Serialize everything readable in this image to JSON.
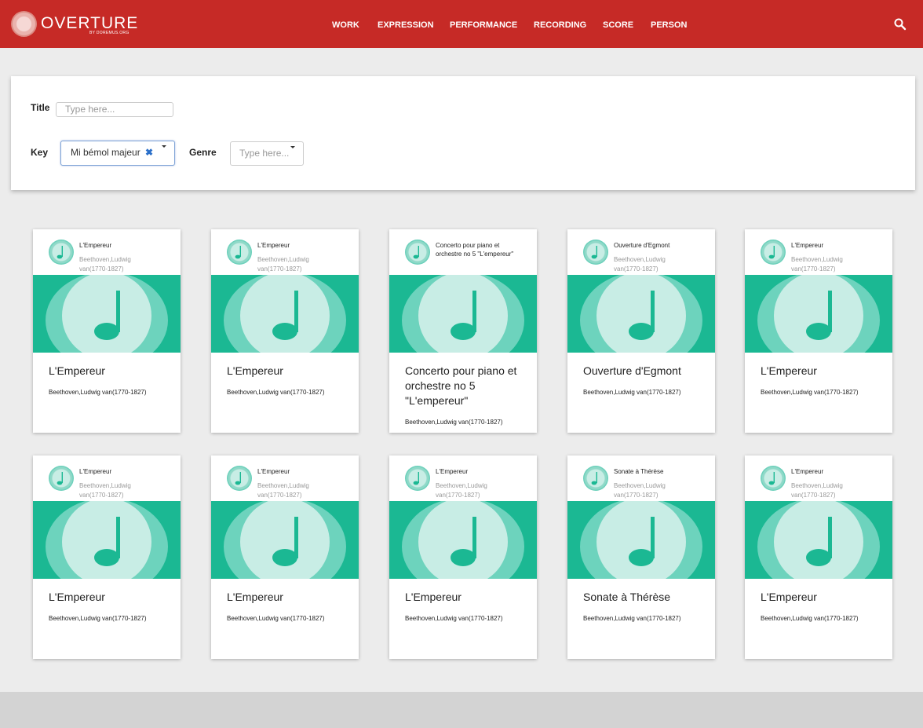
{
  "brand": {
    "name": "OVERTURE",
    "tagline": "BY DOREMUS.ORG",
    "color": "#c62a26"
  },
  "nav": [
    {
      "label": "WORK"
    },
    {
      "label": "EXPRESSION"
    },
    {
      "label": "PERFORMANCE"
    },
    {
      "label": "RECORDING"
    },
    {
      "label": "SCORE"
    },
    {
      "label": "PERSON"
    }
  ],
  "search": {
    "icon": "search-icon"
  },
  "filters": {
    "title_label": "Title",
    "title_placeholder": "Type here...",
    "key_label": "Key",
    "key_value": "Mi bémol majeur",
    "key_clear_icon": "✖",
    "genre_label": "Genre",
    "genre_placeholder": "Type here..."
  },
  "cards": [
    {
      "head_title": "L'Empereur",
      "head_sub": "Beethoven,Ludwig van(1770-1827)",
      "title": "L'Empereur",
      "sub": "Beethoven,Ludwig van(1770-1827)"
    },
    {
      "head_title": "L'Empereur",
      "head_sub": "Beethoven,Ludwig van(1770-1827)",
      "title": "L'Empereur",
      "sub": "Beethoven,Ludwig van(1770-1827)"
    },
    {
      "head_title": "Concerto pour piano et orchestre no 5 \"L'empereur\"",
      "head_sub": "",
      "title": "Concerto pour piano et orchestre no 5 \"L'empereur\"",
      "sub": "Beethoven,Ludwig van(1770-1827)"
    },
    {
      "head_title": "Ouverture d'Egmont",
      "head_sub": "Beethoven,Ludwig van(1770-1827)",
      "title": "Ouverture d'Egmont",
      "sub": "Beethoven,Ludwig van(1770-1827)"
    },
    {
      "head_title": "L'Empereur",
      "head_sub": "Beethoven,Ludwig van(1770-1827)",
      "title": "L'Empereur",
      "sub": "Beethoven,Ludwig van(1770-1827)"
    },
    {
      "head_title": "L'Empereur",
      "head_sub": "Beethoven,Ludwig van(1770-1827)",
      "title": "L'Empereur",
      "sub": "Beethoven,Ludwig van(1770-1827)"
    },
    {
      "head_title": "L'Empereur",
      "head_sub": "Beethoven,Ludwig van(1770-1827)",
      "title": "L'Empereur",
      "sub": "Beethoven,Ludwig van(1770-1827)"
    },
    {
      "head_title": "L'Empereur",
      "head_sub": "Beethoven,Ludwig van(1770-1827)",
      "title": "L'Empereur",
      "sub": "Beethoven,Ludwig van(1770-1827)"
    },
    {
      "head_title": "Sonate à Thérèse",
      "head_sub": "Beethoven,Ludwig van(1770-1827)",
      "title": "Sonate à Thérèse",
      "sub": "Beethoven,Ludwig van(1770-1827)"
    },
    {
      "head_title": "L'Empereur",
      "head_sub": "Beethoven,Ludwig van(1770-1827)",
      "title": "L'Empereur",
      "sub": "Beethoven,Ludwig van(1770-1827)"
    }
  ],
  "colors": {
    "accent": "#1bb893",
    "header": "#c62a26",
    "background": "#ececec"
  }
}
